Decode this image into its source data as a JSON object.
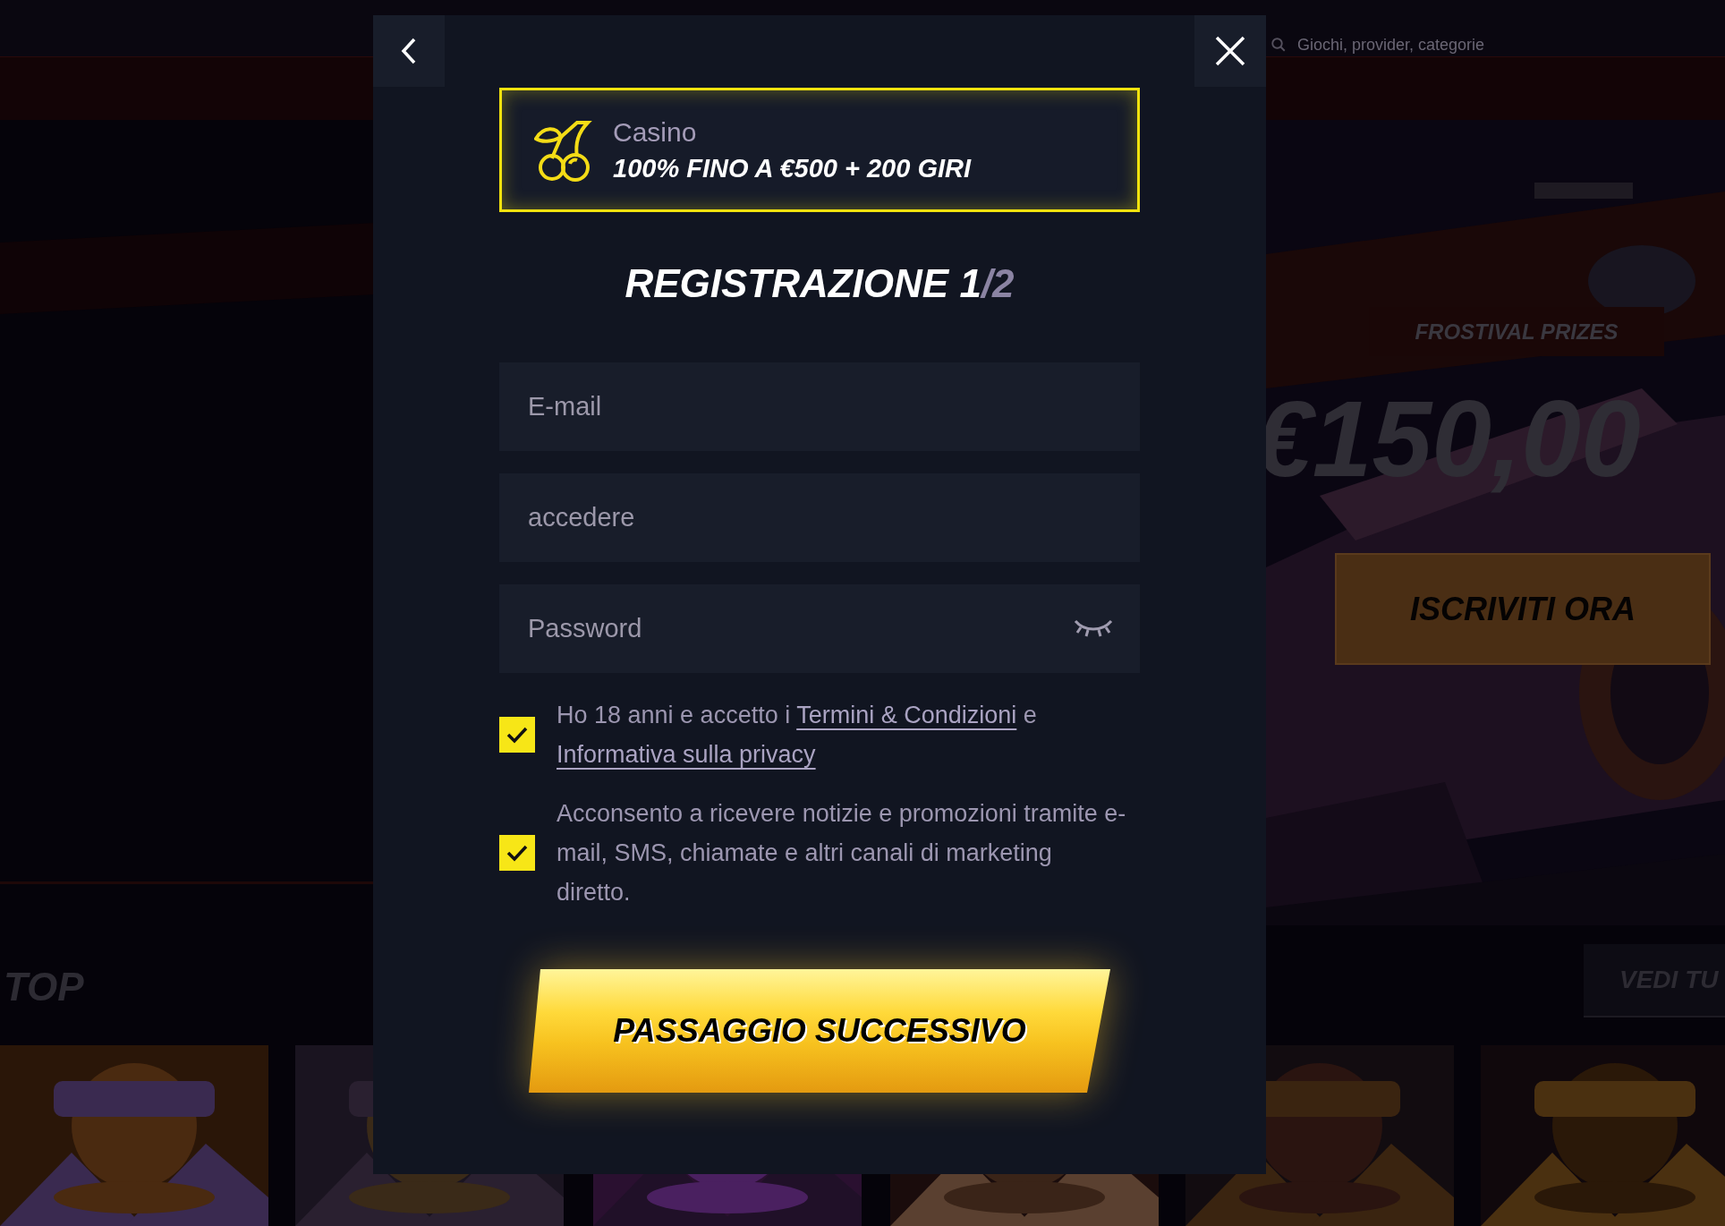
{
  "background": {
    "header": {
      "search_placeholder": "Giochi, provider, categorie"
    },
    "hero": {
      "kicker": "FROSTIVAL PRIZES",
      "amount": "€150,00",
      "cta": "ISCRIVITI ORA"
    },
    "section": {
      "title": "TOP",
      "see_all": "VEDI TU"
    }
  },
  "modal": {
    "promo": {
      "category": "Casino",
      "offer": "100% FINO A €500 + 200 GIRI"
    },
    "title": {
      "main": "REGISTRAZIONE 1",
      "step": "/2"
    },
    "fields": [
      {
        "kind": "text",
        "placeholder": "E-mail"
      },
      {
        "kind": "text",
        "placeholder": "accedere"
      },
      {
        "kind": "password",
        "placeholder": "Password"
      }
    ],
    "consents": [
      {
        "checked": true,
        "parts": [
          {
            "kind": "text",
            "text": "Ho 18 anni e accetto i "
          },
          {
            "kind": "link",
            "text": "Termini & Condizioni"
          },
          {
            "kind": "text",
            "text": " e "
          },
          {
            "kind": "link",
            "text": "Informativa sulla privacy"
          }
        ]
      },
      {
        "checked": true,
        "parts": [
          {
            "kind": "text",
            "text": "Acconsento a ricevere notizie e promozioni tramite e-mail, SMS, chiamate e altri canali di marketing diretto."
          }
        ]
      }
    ],
    "submit": "PASSAGGIO SUCCESSIVO"
  }
}
